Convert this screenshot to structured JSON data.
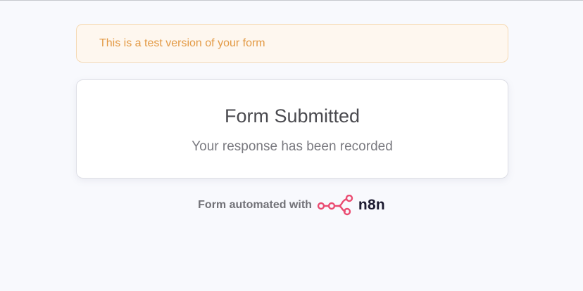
{
  "banner": {
    "text": "This is a test version of your form"
  },
  "card": {
    "title": "Form Submitted",
    "subtitle": "Your response has been recorded"
  },
  "footer": {
    "text": "Form automated with",
    "brand": "n8n",
    "logo_icon": "n8n-logo-icon"
  },
  "colors": {
    "background": "#f8f9fd",
    "banner_bg": "#fef7ef",
    "banner_text": "#e39a45",
    "brand_pink": "#ea4b71",
    "brand_text": "#1d1b31"
  }
}
